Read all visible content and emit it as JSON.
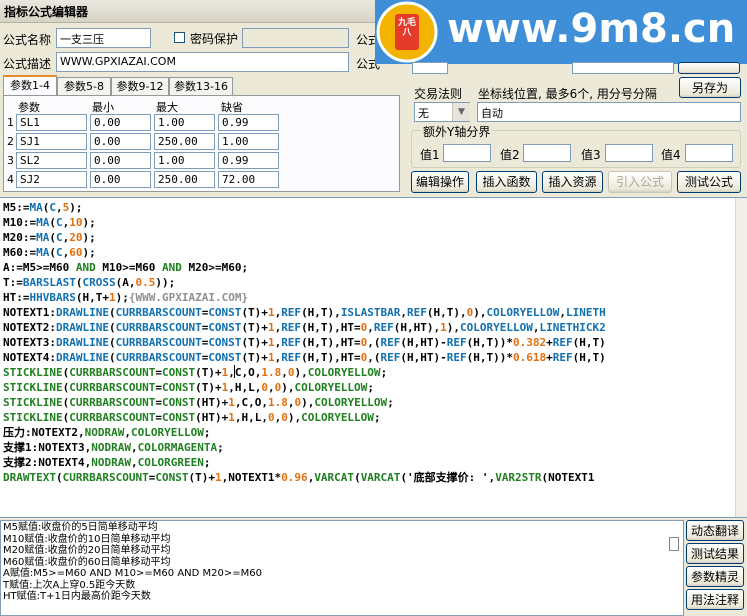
{
  "window": {
    "title": "指标公式编辑器"
  },
  "form": {
    "name_label": "公式名称",
    "name_value": "一支三压",
    "password_label": "密码保护",
    "desc_label": "公式描述",
    "desc_value": "WWW.GPXIAZAI.COM",
    "right_label_1": "公式",
    "right_label_2": "公式"
  },
  "tabs": [
    "参数1-4",
    "参数5-8",
    "参数9-12",
    "参数13-16"
  ],
  "params": {
    "headers": [
      "参数",
      "最小",
      "最大",
      "缺省"
    ],
    "rows": [
      {
        "n": "1",
        "name": "SL1",
        "min": "0.00",
        "max": "1.00",
        "def": "0.99"
      },
      {
        "n": "2",
        "name": "SJ1",
        "min": "0.00",
        "max": "250.00",
        "def": "1.00"
      },
      {
        "n": "3",
        "name": "SL2",
        "min": "0.00",
        "max": "1.00",
        "def": "0.99"
      },
      {
        "n": "4",
        "name": "SJ2",
        "min": "0.00",
        "max": "250.00",
        "def": "72.00"
      }
    ]
  },
  "trade": {
    "rule_label": "交易法则",
    "rule_value": "无",
    "coord_label": "坐标线位置, 最多6个, 用分号分隔",
    "coord_value": "自动",
    "save_as": "另存为"
  },
  "yaxis": {
    "title": "额外Y轴分界",
    "labels": [
      "值1",
      "值2",
      "值3",
      "值4"
    ]
  },
  "actions": [
    "编辑操作",
    "插入函数",
    "插入资源",
    "引入公式",
    "测试公式"
  ],
  "watermark": {
    "site": "www.9m8.cn",
    "badge": "九毛八"
  },
  "code": [
    [
      [
        "M5:=",
        "#000"
      ],
      [
        "MA",
        "#1070b0"
      ],
      [
        "(",
        "#000"
      ],
      [
        "C",
        "#1070b0"
      ],
      [
        ",",
        "#000"
      ],
      [
        "5",
        "#e07010"
      ],
      [
        ");",
        "#000"
      ]
    ],
    [
      [
        "M10:=",
        "#000"
      ],
      [
        "MA",
        "#1070b0"
      ],
      [
        "(",
        "#000"
      ],
      [
        "C",
        "#1070b0"
      ],
      [
        ",",
        "#000"
      ],
      [
        "10",
        "#e07010"
      ],
      [
        ");",
        "#000"
      ]
    ],
    [
      [
        "M20:=",
        "#000"
      ],
      [
        "MA",
        "#1070b0"
      ],
      [
        "(",
        "#000"
      ],
      [
        "C",
        "#1070b0"
      ],
      [
        ",",
        "#000"
      ],
      [
        "20",
        "#e07010"
      ],
      [
        ");",
        "#000"
      ]
    ],
    [
      [
        "M60:=",
        "#000"
      ],
      [
        "MA",
        "#1070b0"
      ],
      [
        "(",
        "#000"
      ],
      [
        "C",
        "#1070b0"
      ],
      [
        ",",
        "#000"
      ],
      [
        "60",
        "#e07010"
      ],
      [
        ");",
        "#000"
      ]
    ],
    [
      [
        "A:=M5>=M60 ",
        "#000"
      ],
      [
        "AND",
        "#208020"
      ],
      [
        " M10>=M60 ",
        "#000"
      ],
      [
        "AND",
        "#208020"
      ],
      [
        " M20>=M60;",
        "#000"
      ]
    ],
    [
      [
        "T:=",
        "#000"
      ],
      [
        "BARSLAST",
        "#1070b0"
      ],
      [
        "(",
        "#000"
      ],
      [
        "CROSS",
        "#1070b0"
      ],
      [
        "(A,",
        "#000"
      ],
      [
        "0.5",
        "#e07010"
      ],
      [
        "));",
        "#000"
      ]
    ],
    [
      [
        "HT:=",
        "#000"
      ],
      [
        "HHVBARS",
        "#1070b0"
      ],
      [
        "(H,T+",
        "#000"
      ],
      [
        "1",
        "#e07010"
      ],
      [
        ");",
        "#000"
      ],
      [
        "{WWW.GPXIAZAI.COM}",
        "#909090"
      ]
    ],
    [
      [
        "NOTEXT1:",
        "#000"
      ],
      [
        "DRAWLINE",
        "#1070b0"
      ],
      [
        "(",
        "#000"
      ],
      [
        "CURRBARSCOUNT",
        "#1070b0"
      ],
      [
        "=",
        "#000"
      ],
      [
        "CONST",
        "#1070b0"
      ],
      [
        "(T)+",
        "#000"
      ],
      [
        "1",
        "#e07010"
      ],
      [
        ",",
        "#000"
      ],
      [
        "REF",
        "#1070b0"
      ],
      [
        "(H,T),",
        "#000"
      ],
      [
        "ISLASTBAR",
        "#1070b0"
      ],
      [
        ",",
        "#000"
      ],
      [
        "REF",
        "#1070b0"
      ],
      [
        "(H,T),",
        "#000"
      ],
      [
        "0",
        "#e07010"
      ],
      [
        "),",
        "#000"
      ],
      [
        "COLORYELLOW",
        "#1070b0"
      ],
      [
        ",",
        "#000"
      ],
      [
        "LINETH",
        "#1070b0"
      ]
    ],
    [
      [
        "NOTEXT2:",
        "#000"
      ],
      [
        "DRAWLINE",
        "#1070b0"
      ],
      [
        "(",
        "#000"
      ],
      [
        "CURRBARSCOUNT",
        "#1070b0"
      ],
      [
        "=",
        "#000"
      ],
      [
        "CONST",
        "#1070b0"
      ],
      [
        "(T)+",
        "#000"
      ],
      [
        "1",
        "#e07010"
      ],
      [
        ",",
        "#000"
      ],
      [
        "REF",
        "#1070b0"
      ],
      [
        "(H,T),HT=",
        "#000"
      ],
      [
        "0",
        "#e07010"
      ],
      [
        ",",
        "#000"
      ],
      [
        "REF",
        "#1070b0"
      ],
      [
        "(H,HT),",
        "#000"
      ],
      [
        "1",
        "#e07010"
      ],
      [
        "),",
        "#000"
      ],
      [
        "COLORYELLOW",
        "#1070b0"
      ],
      [
        ",",
        "#000"
      ],
      [
        "LINETHICK2",
        "#1070b0"
      ]
    ],
    [
      [
        "NOTEXT3:",
        "#000"
      ],
      [
        "DRAWLINE",
        "#1070b0"
      ],
      [
        "(",
        "#000"
      ],
      [
        "CURRBARSCOUNT",
        "#1070b0"
      ],
      [
        "=",
        "#000"
      ],
      [
        "CONST",
        "#1070b0"
      ],
      [
        "(T)+",
        "#000"
      ],
      [
        "1",
        "#e07010"
      ],
      [
        ",",
        "#000"
      ],
      [
        "REF",
        "#1070b0"
      ],
      [
        "(H,T),HT=",
        "#000"
      ],
      [
        "0",
        "#e07010"
      ],
      [
        ",(",
        "#000"
      ],
      [
        "REF",
        "#1070b0"
      ],
      [
        "(H,HT)-",
        "#000"
      ],
      [
        "REF",
        "#1070b0"
      ],
      [
        "(H,T))*",
        "#000"
      ],
      [
        "0.382",
        "#e07010"
      ],
      [
        "+",
        "#000"
      ],
      [
        "REF",
        "#1070b0"
      ],
      [
        "(H,T)",
        "#000"
      ]
    ],
    [
      [
        "NOTEXT4:",
        "#000"
      ],
      [
        "DRAWLINE",
        "#1070b0"
      ],
      [
        "(",
        "#000"
      ],
      [
        "CURRBARSCOUNT",
        "#1070b0"
      ],
      [
        "=",
        "#000"
      ],
      [
        "CONST",
        "#1070b0"
      ],
      [
        "(T)+",
        "#000"
      ],
      [
        "1",
        "#e07010"
      ],
      [
        ",",
        "#000"
      ],
      [
        "REF",
        "#1070b0"
      ],
      [
        "(H,T),HT=",
        "#000"
      ],
      [
        "0",
        "#e07010"
      ],
      [
        ",(",
        "#000"
      ],
      [
        "REF",
        "#1070b0"
      ],
      [
        "(H,HT)-",
        "#000"
      ],
      [
        "REF",
        "#1070b0"
      ],
      [
        "(H,T))*",
        "#000"
      ],
      [
        "0.618",
        "#e07010"
      ],
      [
        "+",
        "#000"
      ],
      [
        "REF",
        "#1070b0"
      ],
      [
        "(H,T)",
        "#000"
      ]
    ],
    [
      [
        "STICKLINE",
        "#208020"
      ],
      [
        "(",
        "#000"
      ],
      [
        "CURRBARSCOUNT",
        "#208020"
      ],
      [
        "=",
        "#000"
      ],
      [
        "CONST",
        "#208020"
      ],
      [
        "(T)+",
        "#000"
      ],
      [
        "1",
        "#e07010"
      ],
      [
        ",C,O,",
        "#000"
      ],
      [
        "1.8",
        "#e07010"
      ],
      [
        ",",
        "#000"
      ],
      [
        "0",
        "#e07010"
      ],
      [
        "),",
        "#000"
      ],
      [
        "COLORYELLOW",
        "#208020"
      ],
      [
        ";",
        "#000"
      ]
    ],
    [
      [
        "STICKLINE",
        "#208020"
      ],
      [
        "(",
        "#000"
      ],
      [
        "CURRBARSCOUNT",
        "#208020"
      ],
      [
        "=",
        "#000"
      ],
      [
        "CONST",
        "#208020"
      ],
      [
        "(T)+",
        "#000"
      ],
      [
        "1",
        "#e07010"
      ],
      [
        ",H,L,",
        "#000"
      ],
      [
        "0",
        "#e07010"
      ],
      [
        ",",
        "#000"
      ],
      [
        "0",
        "#e07010"
      ],
      [
        "),",
        "#000"
      ],
      [
        "COLORYELLOW",
        "#208020"
      ],
      [
        ";",
        "#000"
      ]
    ],
    [
      [
        "STICKLINE",
        "#208020"
      ],
      [
        "(",
        "#000"
      ],
      [
        "CURRBARSCOUNT",
        "#208020"
      ],
      [
        "=",
        "#000"
      ],
      [
        "CONST",
        "#208020"
      ],
      [
        "(HT)+",
        "#000"
      ],
      [
        "1",
        "#e07010"
      ],
      [
        ",C,O,",
        "#000"
      ],
      [
        "1.8",
        "#e07010"
      ],
      [
        ",",
        "#000"
      ],
      [
        "0",
        "#e07010"
      ],
      [
        "),",
        "#000"
      ],
      [
        "COLORYELLOW",
        "#208020"
      ],
      [
        ";",
        "#000"
      ]
    ],
    [
      [
        "STICKLINE",
        "#208020"
      ],
      [
        "(",
        "#000"
      ],
      [
        "CURRBARSCOUNT",
        "#208020"
      ],
      [
        "=",
        "#000"
      ],
      [
        "CONST",
        "#208020"
      ],
      [
        "(HT)+",
        "#000"
      ],
      [
        "1",
        "#e07010"
      ],
      [
        ",H,L,",
        "#000"
      ],
      [
        "0",
        "#e07010"
      ],
      [
        ",",
        "#000"
      ],
      [
        "0",
        "#e07010"
      ],
      [
        "),",
        "#000"
      ],
      [
        "COLORYELLOW",
        "#208020"
      ],
      [
        ";",
        "#000"
      ]
    ],
    [
      [
        "压力:NOTEXT2,",
        "#000"
      ],
      [
        "NODRAW",
        "#208020"
      ],
      [
        ",",
        "#000"
      ],
      [
        "COLORYELLOW",
        "#208020"
      ],
      [
        ";",
        "#000"
      ]
    ],
    [
      [
        "支撑1:NOTEXT3,",
        "#000"
      ],
      [
        "NODRAW",
        "#208020"
      ],
      [
        ",",
        "#000"
      ],
      [
        "COLORMAGENTA",
        "#208020"
      ],
      [
        ";",
        "#000"
      ]
    ],
    [
      [
        "支撑2:NOTEXT4,",
        "#000"
      ],
      [
        "NODRAW",
        "#208020"
      ],
      [
        ",",
        "#000"
      ],
      [
        "COLORGREEN",
        "#208020"
      ],
      [
        ";",
        "#000"
      ]
    ],
    [
      [
        "DRAWTEXT",
        "#208020"
      ],
      [
        "(",
        "#000"
      ],
      [
        "CURRBARSCOUNT",
        "#208020"
      ],
      [
        "=",
        "#000"
      ],
      [
        "CONST",
        "#208020"
      ],
      [
        "(T)+",
        "#000"
      ],
      [
        "1",
        "#e07010"
      ],
      [
        ",NOTEXT1*",
        "#000"
      ],
      [
        "0.96",
        "#e07010"
      ],
      [
        ",",
        "#000"
      ],
      [
        "VARCAT",
        "#208020"
      ],
      [
        "(",
        "#000"
      ],
      [
        "VARCAT",
        "#208020"
      ],
      [
        "('底部支撑价: ',",
        "#000"
      ],
      [
        "VAR2STR",
        "#208020"
      ],
      [
        "(NOTEXT1",
        "#000"
      ]
    ]
  ],
  "notes": [
    "M5赋值:收盘价的5日简单移动平均",
    "M10赋值:收盘价的10日简单移动平均",
    "M20赋值:收盘价的20日简单移动平均",
    "M60赋值:收盘价的60日简单移动平均",
    "A赋值:M5>=M60 AND M10>=M60 AND M20>=M60",
    "T赋值:上次A上穿0.5距今天数",
    "HT赋值:T+1日内最高价距今天数"
  ],
  "side_buttons": [
    "动态翻译",
    "测试结果",
    "参数精灵",
    "用法注释"
  ]
}
